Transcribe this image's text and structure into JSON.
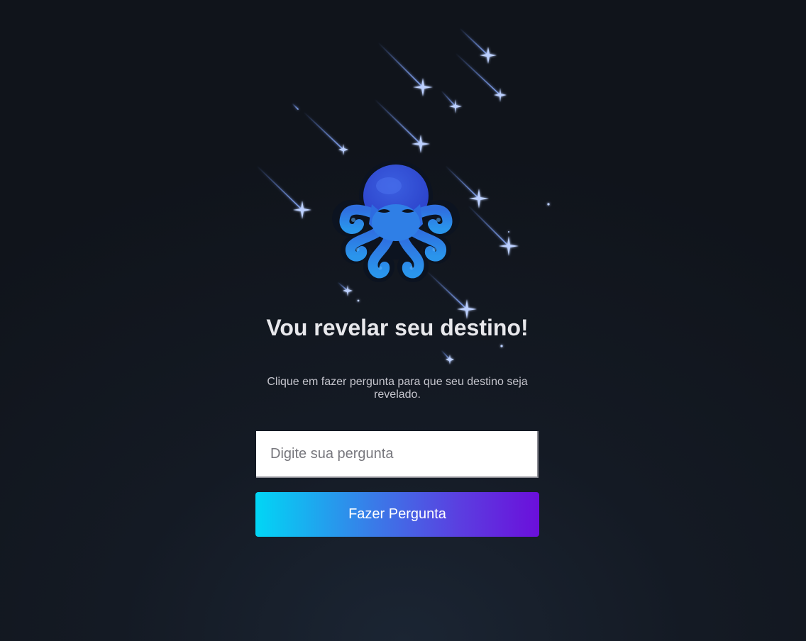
{
  "header": {
    "title": "Vou revelar seu destino!",
    "subtitle": "Clique em fazer pergunta para que seu destino seja revelado."
  },
  "form": {
    "question_placeholder": "Digite sua pergunta",
    "question_value": "",
    "submit_label": "Fazer Pergunta"
  },
  "icons": {
    "logo": "octopus-icon",
    "background": "shooting-stars"
  },
  "colors": {
    "background": "#141a24",
    "accent_start": "#01d6f5",
    "accent_end": "#6b0fdb",
    "octopus": "#2f7fe6",
    "stars": "#6f96ff"
  }
}
